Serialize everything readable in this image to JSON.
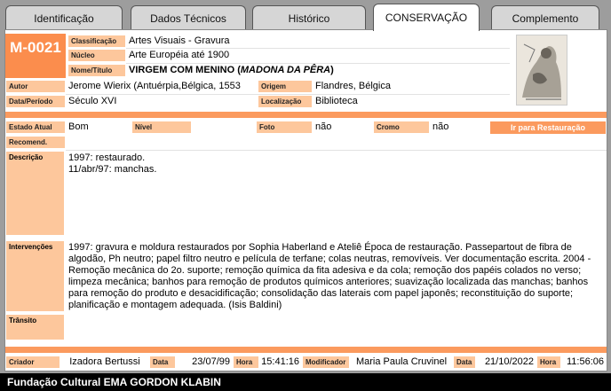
{
  "tabs": [
    "Identificação",
    "Dados Técnicos",
    "Histórico",
    "CONSERVAÇÃO",
    "Complemento"
  ],
  "record": {
    "code": "M-0021",
    "classificacao_label": "Classificação",
    "classificacao": "Artes Visuais - Gravura",
    "nucleo_label": "Núcleo",
    "nucleo": "Arte Européia até 1900",
    "nome_label": "Nome/Título",
    "nome_main": "VIRGEM COM MENINO (",
    "nome_italic": "MADONA DA PÊRA",
    "nome_end": ")",
    "autor_label": "Autor",
    "autor": "Jerome Wierix (Antuérpia,Bélgica, 1553",
    "origem_label": "Origem",
    "origem": "Flandres, Bélgica",
    "data_label": "Data/Período",
    "data": "Século XVI",
    "localizacao_label": "Localização",
    "localizacao": "Biblioteca"
  },
  "estado": {
    "estado_label": "Estado Atual",
    "estado": "Bom",
    "nivel_label": "Nível",
    "nivel": "",
    "foto_label": "Foto",
    "foto": "não",
    "cromo_label": "Cromo",
    "cromo": "não",
    "restauracao_button": "Ir para Restauração",
    "recomend_label": "Recomend.",
    "descricao_label": "Descrição",
    "descricao_lines": [
      "1997: restaurado.",
      "11/abr/97: manchas."
    ],
    "intervencoes_label": "Intervenções",
    "intervencoes": "1997: gravura e moldura restaurados por Sophia Haberland e Ateliê Época de restauração. Passepartout de fibra de algodão, Ph neutro; papel filtro neutro e película de terfane; colas neutras, removíveis. Ver documentação escrita. 2004 - Remoção mecânica do 2o. suporte; remoção química da fita adesiva e da cola; remoção dos papéis colados no verso; limpeza mecânica; banhos para remoção de produtos químicos anteriores; suavização localizada das manchas; banhos para remoção do produto e desacidificação; consolidação das laterais com papel japonês; reconstituição do suporte; planificação e montagem adequada. (Isis Baldini)",
    "transito_label": "Trânsito"
  },
  "audit": {
    "criador_label": "Criador",
    "criador": "Izadora Bertussi",
    "data1_label": "Data",
    "data1": "23/07/99",
    "hora1_label": "Hora",
    "hora1": "15:41:16",
    "modificador_label": "Modificador",
    "modificador": "Maria Paula Cruvinel",
    "data2_label": "Data",
    "data2": "21/10/2022",
    "hora2_label": "Hora",
    "hora2": "11:56:06"
  },
  "footer": "Fundação Cultural EMA GORDON KLABIN",
  "colors": {
    "accent": "#fb9a5e",
    "label_bg": "#fdc79c",
    "code_bg": "#fb8d4d"
  }
}
